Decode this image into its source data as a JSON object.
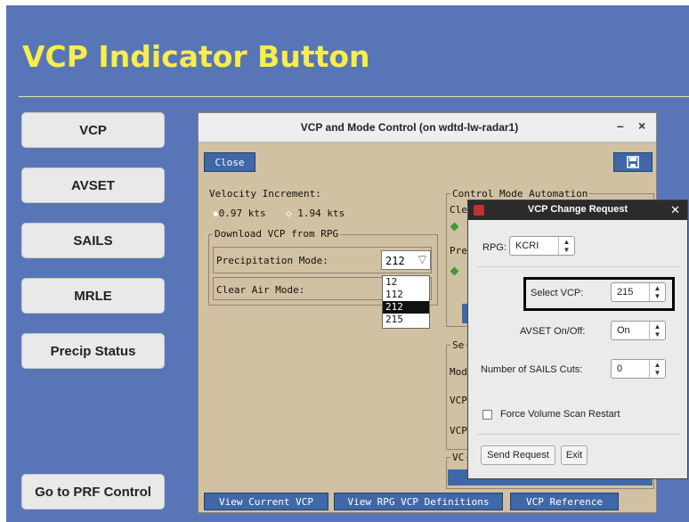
{
  "slide": {
    "title": "VCP Indicator Button",
    "side_buttons": [
      "VCP",
      "AVSET",
      "SAILS",
      "MRLE",
      "Precip Status"
    ],
    "bottom_button": "Go to PRF Control"
  },
  "vcp_dialog": {
    "title": "VCP and Mode Control (on wdtd-lw-radar1)",
    "minimize_glyph": "–",
    "close_glyph": "×",
    "close_button": "Close",
    "velocity_increment_label": "Velocity Increment:",
    "velocity_options": [
      "0.97 kts",
      "1.94 kts"
    ],
    "download_group_label": "Download VCP from RPG",
    "precip_mode_label": "Precipitation Mode:",
    "precip_mode_value": "212",
    "precip_options": [
      "12",
      "112",
      "212",
      "215"
    ],
    "precip_selected": "212",
    "clear_air_label": "Clear Air Mode:",
    "control_mode_label": "Control Mode Automation",
    "partial_cle": "Cle",
    "partial_pre": "Pre",
    "partial_se": "Se",
    "partial_mod": "Mod",
    "partial_vcp1": "VCP",
    "partial_vcp2": "VCP",
    "partial_vc": "VC",
    "bottom_buttons": [
      "View Current VCP",
      "View RPG VCP Definitions",
      "VCP Reference"
    ]
  },
  "change_request": {
    "title": "VCP Change Request",
    "close_glyph": "✕",
    "rpg_label": "RPG:",
    "rpg_value": "KCRI",
    "select_vcp_label": "Select VCP:",
    "select_vcp_value": "215",
    "avset_label": "AVSET On/Off:",
    "avset_value": "On",
    "sails_label": "Number of SAILS Cuts:",
    "sails_value": "0",
    "restart_label": "Force Volume Scan Restart",
    "send_button": "Send Request",
    "exit_button": "Exit"
  },
  "colors": {
    "slide_bg": "#5876b7",
    "title_yellow": "#f7ee4a",
    "dialog_tan": "#d1c1a3",
    "button_blue": "#3f68a8",
    "highlight_box": "#000000"
  }
}
